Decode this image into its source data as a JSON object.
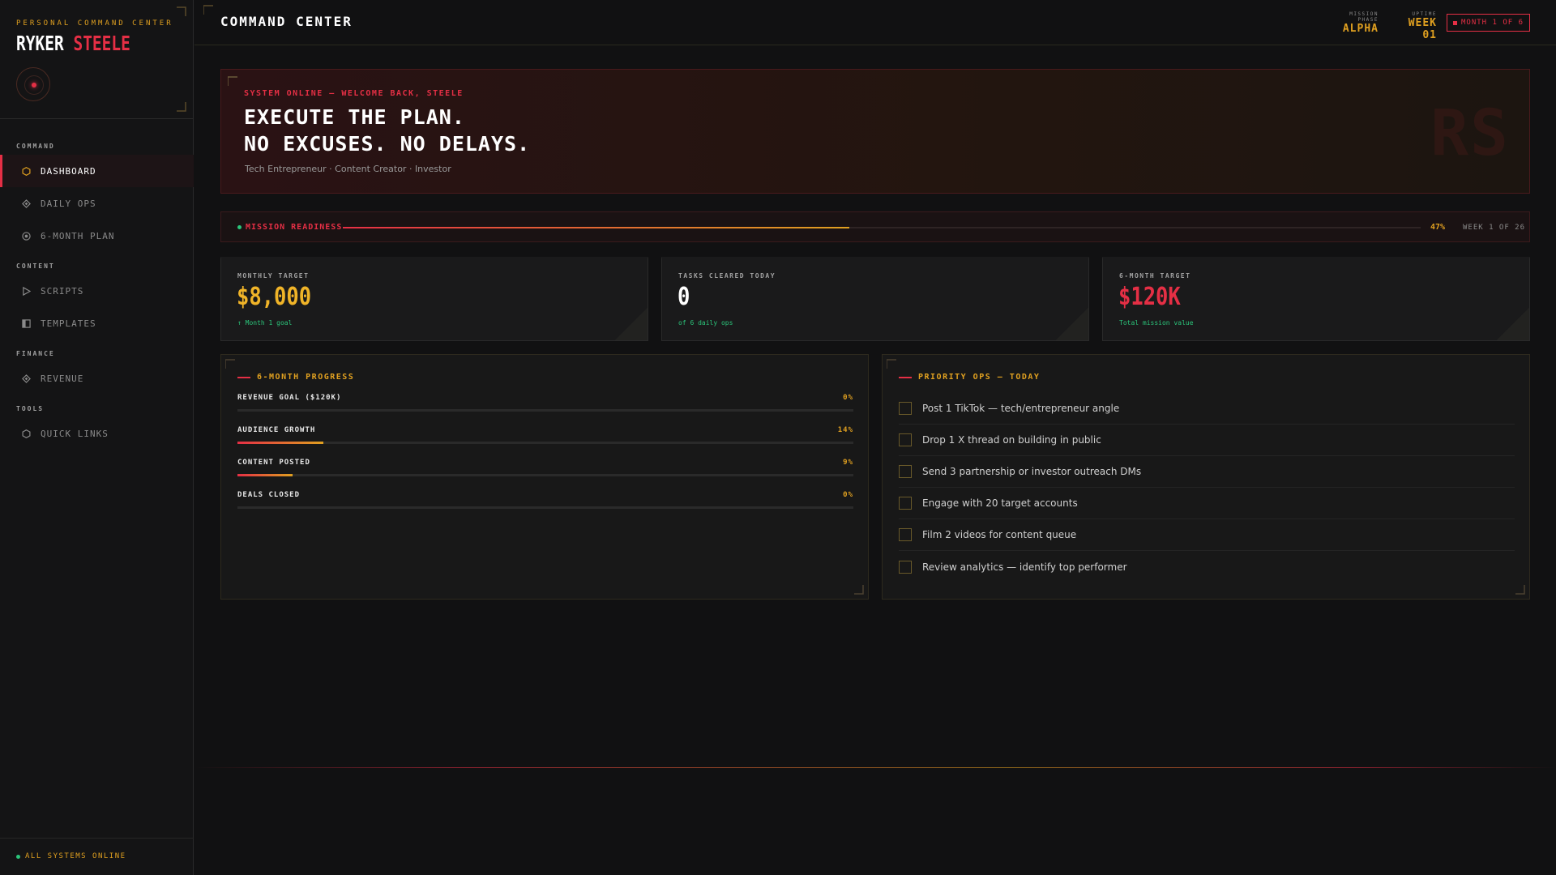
{
  "sidebar": {
    "brand_sub": "PERSONAL COMMAND CENTER",
    "brand_first": "RYKER",
    "brand_last": "STEELE",
    "sections": [
      {
        "label": "COMMAND"
      },
      {
        "label": "CONTENT"
      },
      {
        "label": "FINANCE"
      },
      {
        "label": "TOOLS"
      }
    ],
    "items": [
      {
        "label": "DASHBOARD",
        "icon": "hexagon-icon",
        "active": true
      },
      {
        "label": "DAILY OPS",
        "icon": "diamond-icon"
      },
      {
        "label": "6-MONTH PLAN",
        "icon": "target-icon"
      },
      {
        "label": "SCRIPTS",
        "icon": "play-icon"
      },
      {
        "label": "TEMPLATES",
        "icon": "template-icon"
      },
      {
        "label": "REVENUE",
        "icon": "diamond-icon"
      },
      {
        "label": "QUICK LINKS",
        "icon": "hexagon-icon"
      }
    ],
    "status": "ALL SYSTEMS ONLINE"
  },
  "topbar": {
    "title": "COMMAND CENTER",
    "mission_phase_label": "MISSION PHASE",
    "mission_phase_value": "ALPHA",
    "uptime_label": "UPTIME",
    "uptime_value": "WEEK 01",
    "month_badge": "MONTH 1 OF 6"
  },
  "hero": {
    "subtitle": "SYSTEM ONLINE — WELCOME BACK, STEELE",
    "title_line1": "EXECUTE THE PLAN.",
    "title_line2": "NO EXCUSES. NO DELAYS.",
    "tagline": "Tech Entrepreneur · Content Creator · Investor",
    "watermark": "RS"
  },
  "readiness": {
    "label": "MISSION READINESS",
    "percent_text": "47%",
    "percent": 47,
    "week": "WEEK 1 OF 26"
  },
  "stats": [
    {
      "label": "MONTHLY TARGET",
      "value": "$8,000",
      "note": "↑ Month 1 goal",
      "color": "#f0b428"
    },
    {
      "label": "TASKS CLEARED TODAY",
      "value": "0",
      "note": "of 6 daily ops",
      "color": "#ffffff"
    },
    {
      "label": "6-MONTH TARGET",
      "value": "$120K",
      "note": "Total mission value",
      "color": "#e52f45"
    }
  ],
  "progress": {
    "title": "6-MONTH PROGRESS",
    "items": [
      {
        "label": "REVENUE GOAL ($120K)",
        "pct_text": "0%",
        "pct": 0
      },
      {
        "label": "AUDIENCE GROWTH",
        "pct_text": "14%",
        "pct": 14
      },
      {
        "label": "CONTENT POSTED",
        "pct_text": "9%",
        "pct": 9
      },
      {
        "label": "DEALS CLOSED",
        "pct_text": "0%",
        "pct": 0
      }
    ]
  },
  "ops": {
    "title": "PRIORITY OPS — TODAY",
    "items": [
      "Post 1 TikTok — tech/entrepreneur angle",
      "Drop 1 X thread on building in public",
      "Send 3 partnership or investor outreach DMs",
      "Engage with 20 target accounts",
      "Film 2 videos for content queue",
      "Review analytics — identify top performer"
    ]
  },
  "colors": {
    "accent_red": "#e52f45",
    "accent_gold": "#e0a020",
    "status_green": "#2bc47a"
  }
}
